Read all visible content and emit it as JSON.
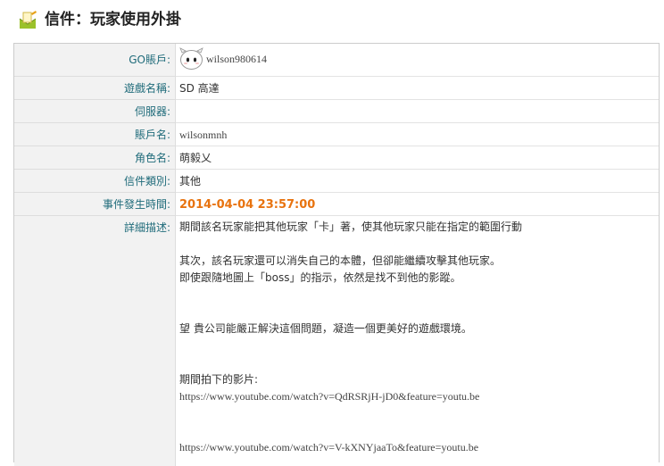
{
  "page": {
    "title": "信件：玩家使用外掛"
  },
  "fields": [
    {
      "label": "GO賬戶:",
      "value": "wilson980614"
    },
    {
      "label": "遊戲名稱:",
      "value": "SD 高達"
    },
    {
      "label": "伺服器:",
      "value": ""
    },
    {
      "label": "賬戶名:",
      "value": "wilsonmnh"
    },
    {
      "label": "角色名:",
      "value": "萌毅乂"
    },
    {
      "label": "信件類別:",
      "value": "其他"
    },
    {
      "label": "事件發生時間:",
      "value": "2014-04-04 23:57:00"
    },
    {
      "label": "詳細描述:",
      "value": ""
    }
  ],
  "description": {
    "line1": "期間該名玩家能把其他玩家「卡」著，使其他玩家只能在指定的範圍行動",
    "line2": "其次，該名玩家還可以消失自己的本體，但卻能繼續攻擊其他玩家。",
    "line3": "即使跟隨地圖上「boss」的指示，依然是找不到他的影蹤。",
    "line4": "望 貴公司能嚴正解決這個問題，凝造一個更美好的遊戲環境。",
    "line5": "期間拍下的影片:",
    "link1": "https://www.youtube.com/watch?v=QdRSRjH-jD0&feature=youtu.be",
    "link2": "https://www.youtube.com/watch?v=V-kXNYjaaTo&feature=youtu.be"
  },
  "colors": {
    "label": "#1f6b7a",
    "date": "#e8730f",
    "label_bg": "#f2f2f2"
  }
}
